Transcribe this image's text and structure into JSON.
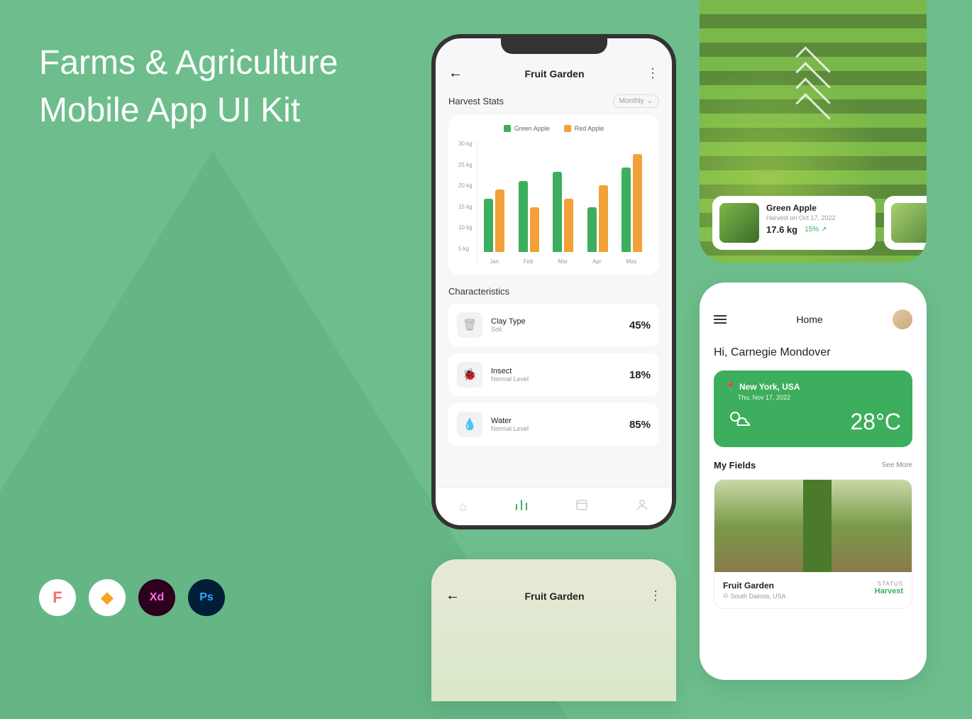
{
  "hero": {
    "line1": "Farms & Agriculture",
    "line2": "Mobile App UI Kit"
  },
  "tools": {
    "figma": "F",
    "sketch": "◆",
    "xd": "Xd",
    "ps": "Ps"
  },
  "phone1": {
    "title": "Fruit Garden",
    "stats_title": "Harvest Stats",
    "dropdown": "Monthly",
    "legend": {
      "green": "Green Apple",
      "red": "Red Apple"
    },
    "characteristics_title": "Characteristics",
    "chars": [
      {
        "label": "Clay Type",
        "sub": "Soil",
        "value": "45%"
      },
      {
        "label": "Insect",
        "sub": "Normal Level",
        "value": "18%"
      },
      {
        "label": "Water",
        "sub": "Normal Level",
        "value": "85%"
      }
    ]
  },
  "chart_data": {
    "type": "bar",
    "categories": [
      "Jan",
      "Feb",
      "Mar",
      "Apr",
      "May"
    ],
    "series": [
      {
        "name": "Green Apple",
        "color": "#3DAE5D",
        "values": [
          17,
          21,
          23,
          15,
          24
        ]
      },
      {
        "name": "Red Apple",
        "color": "#F2A038",
        "values": [
          19,
          15,
          17,
          20,
          27
        ]
      }
    ],
    "ylabel": "kg",
    "yticks": [
      30,
      25,
      20,
      15,
      10,
      5
    ],
    "ylim": [
      5,
      30
    ]
  },
  "phone2": {
    "card": {
      "title": "Green Apple",
      "sub": "Harvest on Oct 17, 2022",
      "kg": "17.6 kg",
      "pct": "15%"
    }
  },
  "phone3": {
    "title": "Home",
    "greeting": "Hi, Carnegie Mondover",
    "weather": {
      "location": "New York, USA",
      "date": "Thu, Nov 17, 2022",
      "temp": "28°C"
    },
    "fields_title": "My Fields",
    "see_more": "See More",
    "field": {
      "name": "Fruit Garden",
      "location": "South Dakota, USA",
      "status_label": "STATUS",
      "status_value": "Harvest"
    }
  },
  "phone4": {
    "title": "Fruit Garden"
  }
}
